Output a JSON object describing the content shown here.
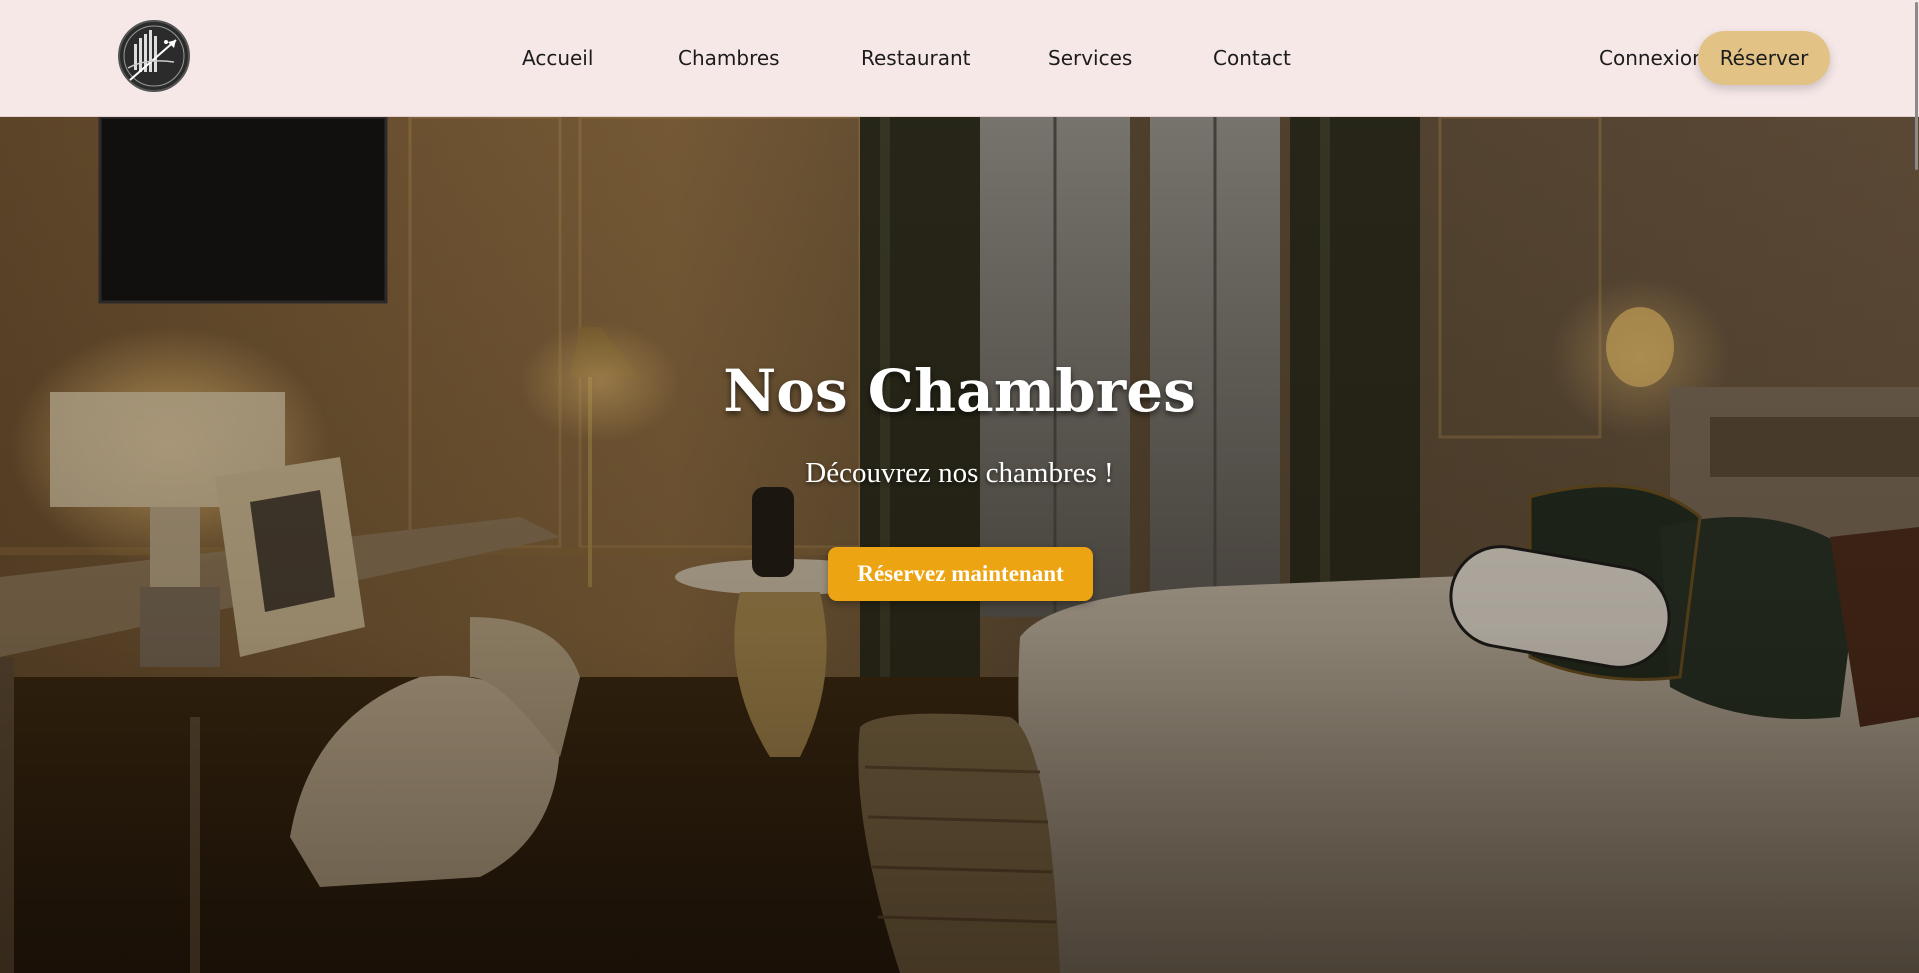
{
  "header": {
    "logo_icon": "hotel-logo-icon",
    "nav": [
      {
        "label": "Accueil"
      },
      {
        "label": "Chambres"
      },
      {
        "label": "Restaurant"
      },
      {
        "label": "Services"
      },
      {
        "label": "Contact"
      }
    ],
    "connexion_label": "Connexion",
    "reserve_label": "Réserver"
  },
  "hero": {
    "title": "Nos Chambres",
    "subtitle": "Découvrez nos chambres !",
    "cta_label": "Réservez maintenant",
    "background": "hotel-room-photo"
  },
  "colors": {
    "header_bg": "#f7e8e8",
    "reserve_button": "#e2c285",
    "cta_button": "#eda412",
    "text_dark": "#1c1c1c",
    "text_light": "#ffffff"
  }
}
